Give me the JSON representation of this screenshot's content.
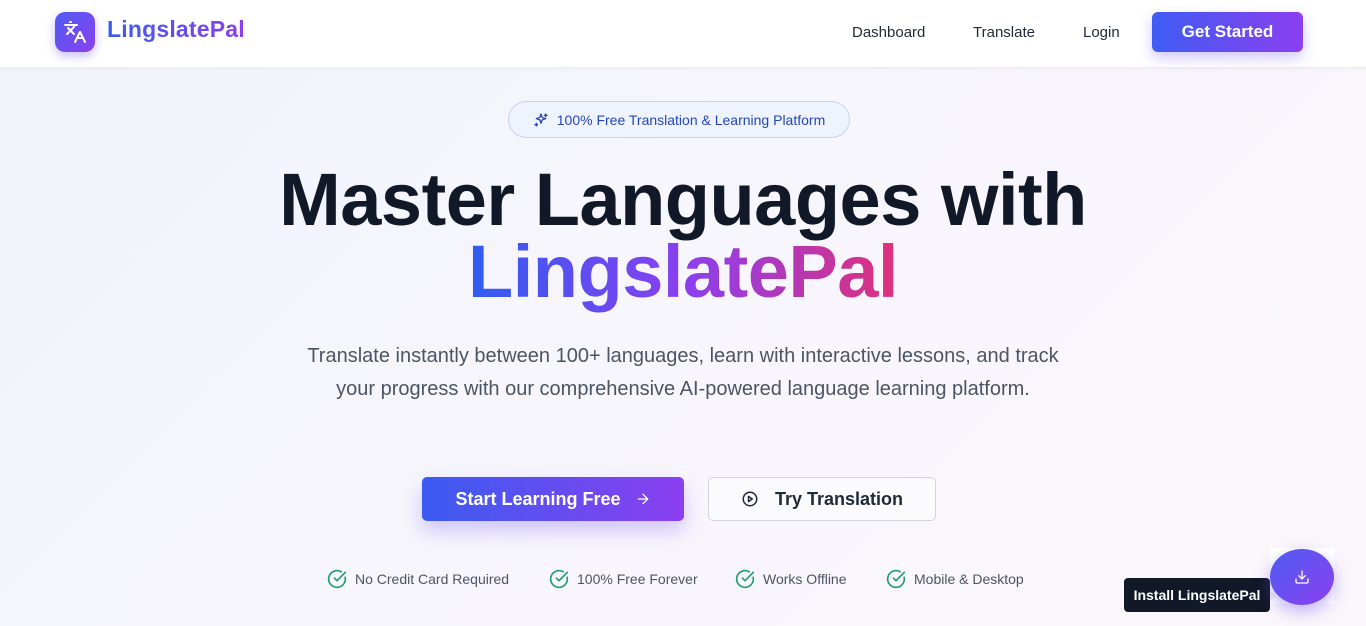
{
  "brand": {
    "name": "LingslatePal",
    "icon": "translate-icon",
    "gradient_start": "#3b5bf0",
    "gradient_end": "#8b3ff0"
  },
  "nav": {
    "items": [
      {
        "label": "Dashboard"
      },
      {
        "label": "Translate"
      },
      {
        "label": "Login"
      }
    ],
    "cta_label": "Get Started"
  },
  "hero": {
    "badge_text": "100% Free Translation & Learning Platform",
    "badge_icon": "sparkles-icon",
    "headline_line1": "Master Languages with",
    "headline_line2": "LingslatePal",
    "subtitle": "Translate instantly between 100+ languages, learn with interactive lessons, and track your progress with our comprehensive AI-powered language learning platform.",
    "primary_button": "Start Learning Free",
    "secondary_button": "Try Translation"
  },
  "features": [
    {
      "label": "No Credit Card Required",
      "icon": "check-circle-icon"
    },
    {
      "label": "100% Free Forever",
      "icon": "check-circle-icon"
    },
    {
      "label": "Works Offline",
      "icon": "check-circle-icon"
    },
    {
      "label": "Mobile & Desktop",
      "icon": "check-circle-icon"
    }
  ],
  "install": {
    "tooltip": "Install LingslatePal",
    "icon": "download-icon"
  },
  "colors": {
    "accent_check": "#1f9d6e",
    "tooltip_bg": "#111827"
  }
}
